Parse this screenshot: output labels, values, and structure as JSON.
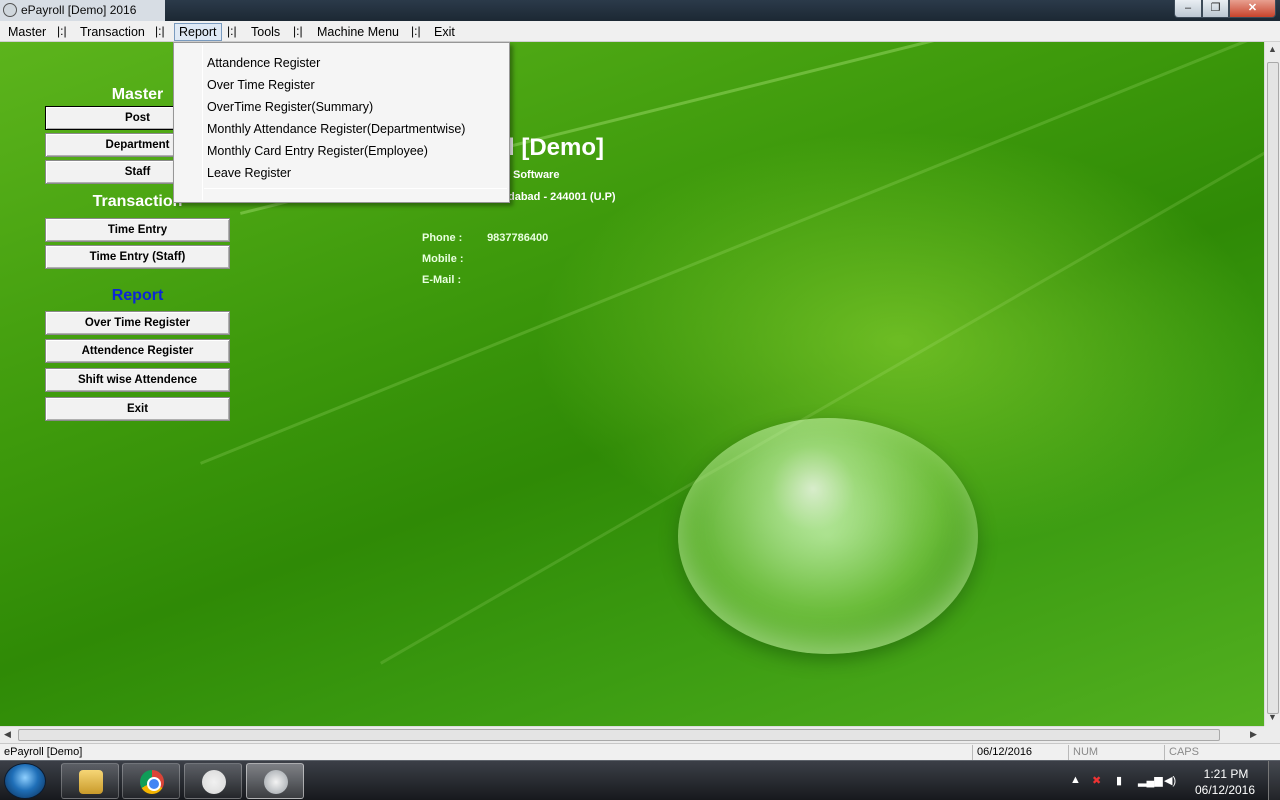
{
  "window": {
    "title": "ePayroll [Demo]     2016",
    "controls": {
      "minimize": "‒",
      "maximize": "❐",
      "close": "✕"
    }
  },
  "menubar": {
    "items": [
      "Master",
      "Transaction",
      "Report",
      "Tools",
      "Machine Menu",
      "Exit"
    ],
    "separator": "|:|",
    "active": "Report"
  },
  "report_menu": {
    "items": [
      "Attandence Register",
      "Over Time Register",
      "OverTime Register(Summary)",
      "Monthly Attendance Register(Departmentwise)",
      "Monthly Card Entry Register(Employee)",
      "Leave Register"
    ]
  },
  "sidebar": {
    "master": {
      "heading": "Master",
      "buttons": [
        "Post",
        "Department",
        "Staff"
      ]
    },
    "transaction": {
      "heading": "Transaction",
      "buttons": [
        "Time  Entry",
        "Time Entry (Staff)"
      ]
    },
    "report": {
      "heading": "Report",
      "buttons": [
        "Over Time Register",
        "Attendence Register",
        "Shift wise Attendence",
        "Exit"
      ]
    }
  },
  "company": {
    "title_visible": "l [Demo]",
    "subtitle_visible": "Software",
    "address_visible": "dabad - 244001 (U.P)",
    "phone_label": "Phone   :",
    "phone_value": "9837786400",
    "mobile_label": "Mobile   :",
    "mobile_value": "",
    "email_label": "E-Mail   :",
    "email_value": ""
  },
  "statusbar": {
    "app": "ePayroll [Demo]",
    "date": "06/12/2016",
    "num": "NUM",
    "caps": "CAPS"
  },
  "taskbar": {
    "apps": [
      "explorer",
      "chrome",
      "paint",
      "epayroll"
    ],
    "clock_time": "1:21 PM",
    "clock_date": "06/12/2016"
  },
  "colors": {
    "report_heading": "#0b27d6",
    "leaf_green": "#3e9a0c"
  }
}
